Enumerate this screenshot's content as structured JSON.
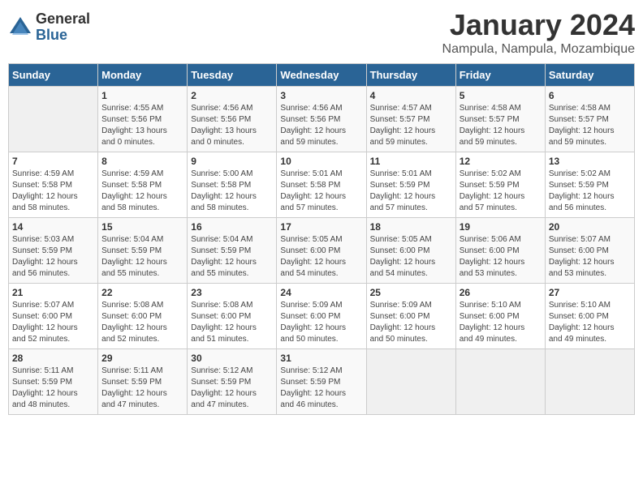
{
  "logo": {
    "general": "General",
    "blue": "Blue"
  },
  "title": "January 2024",
  "location": "Nampula, Nampula, Mozambique",
  "days_of_week": [
    "Sunday",
    "Monday",
    "Tuesday",
    "Wednesday",
    "Thursday",
    "Friday",
    "Saturday"
  ],
  "weeks": [
    [
      {
        "day": "",
        "info": ""
      },
      {
        "day": "1",
        "info": "Sunrise: 4:55 AM\nSunset: 5:56 PM\nDaylight: 13 hours\nand 0 minutes."
      },
      {
        "day": "2",
        "info": "Sunrise: 4:56 AM\nSunset: 5:56 PM\nDaylight: 13 hours\nand 0 minutes."
      },
      {
        "day": "3",
        "info": "Sunrise: 4:56 AM\nSunset: 5:56 PM\nDaylight: 12 hours\nand 59 minutes."
      },
      {
        "day": "4",
        "info": "Sunrise: 4:57 AM\nSunset: 5:57 PM\nDaylight: 12 hours\nand 59 minutes."
      },
      {
        "day": "5",
        "info": "Sunrise: 4:58 AM\nSunset: 5:57 PM\nDaylight: 12 hours\nand 59 minutes."
      },
      {
        "day": "6",
        "info": "Sunrise: 4:58 AM\nSunset: 5:57 PM\nDaylight: 12 hours\nand 59 minutes."
      }
    ],
    [
      {
        "day": "7",
        "info": "Sunrise: 4:59 AM\nSunset: 5:58 PM\nDaylight: 12 hours\nand 58 minutes."
      },
      {
        "day": "8",
        "info": "Sunrise: 4:59 AM\nSunset: 5:58 PM\nDaylight: 12 hours\nand 58 minutes."
      },
      {
        "day": "9",
        "info": "Sunrise: 5:00 AM\nSunset: 5:58 PM\nDaylight: 12 hours\nand 58 minutes."
      },
      {
        "day": "10",
        "info": "Sunrise: 5:01 AM\nSunset: 5:58 PM\nDaylight: 12 hours\nand 57 minutes."
      },
      {
        "day": "11",
        "info": "Sunrise: 5:01 AM\nSunset: 5:59 PM\nDaylight: 12 hours\nand 57 minutes."
      },
      {
        "day": "12",
        "info": "Sunrise: 5:02 AM\nSunset: 5:59 PM\nDaylight: 12 hours\nand 57 minutes."
      },
      {
        "day": "13",
        "info": "Sunrise: 5:02 AM\nSunset: 5:59 PM\nDaylight: 12 hours\nand 56 minutes."
      }
    ],
    [
      {
        "day": "14",
        "info": "Sunrise: 5:03 AM\nSunset: 5:59 PM\nDaylight: 12 hours\nand 56 minutes."
      },
      {
        "day": "15",
        "info": "Sunrise: 5:04 AM\nSunset: 5:59 PM\nDaylight: 12 hours\nand 55 minutes."
      },
      {
        "day": "16",
        "info": "Sunrise: 5:04 AM\nSunset: 5:59 PM\nDaylight: 12 hours\nand 55 minutes."
      },
      {
        "day": "17",
        "info": "Sunrise: 5:05 AM\nSunset: 6:00 PM\nDaylight: 12 hours\nand 54 minutes."
      },
      {
        "day": "18",
        "info": "Sunrise: 5:05 AM\nSunset: 6:00 PM\nDaylight: 12 hours\nand 54 minutes."
      },
      {
        "day": "19",
        "info": "Sunrise: 5:06 AM\nSunset: 6:00 PM\nDaylight: 12 hours\nand 53 minutes."
      },
      {
        "day": "20",
        "info": "Sunrise: 5:07 AM\nSunset: 6:00 PM\nDaylight: 12 hours\nand 53 minutes."
      }
    ],
    [
      {
        "day": "21",
        "info": "Sunrise: 5:07 AM\nSunset: 6:00 PM\nDaylight: 12 hours\nand 52 minutes."
      },
      {
        "day": "22",
        "info": "Sunrise: 5:08 AM\nSunset: 6:00 PM\nDaylight: 12 hours\nand 52 minutes."
      },
      {
        "day": "23",
        "info": "Sunrise: 5:08 AM\nSunset: 6:00 PM\nDaylight: 12 hours\nand 51 minutes."
      },
      {
        "day": "24",
        "info": "Sunrise: 5:09 AM\nSunset: 6:00 PM\nDaylight: 12 hours\nand 50 minutes."
      },
      {
        "day": "25",
        "info": "Sunrise: 5:09 AM\nSunset: 6:00 PM\nDaylight: 12 hours\nand 50 minutes."
      },
      {
        "day": "26",
        "info": "Sunrise: 5:10 AM\nSunset: 6:00 PM\nDaylight: 12 hours\nand 49 minutes."
      },
      {
        "day": "27",
        "info": "Sunrise: 5:10 AM\nSunset: 6:00 PM\nDaylight: 12 hours\nand 49 minutes."
      }
    ],
    [
      {
        "day": "28",
        "info": "Sunrise: 5:11 AM\nSunset: 5:59 PM\nDaylight: 12 hours\nand 48 minutes."
      },
      {
        "day": "29",
        "info": "Sunrise: 5:11 AM\nSunset: 5:59 PM\nDaylight: 12 hours\nand 47 minutes."
      },
      {
        "day": "30",
        "info": "Sunrise: 5:12 AM\nSunset: 5:59 PM\nDaylight: 12 hours\nand 47 minutes."
      },
      {
        "day": "31",
        "info": "Sunrise: 5:12 AM\nSunset: 5:59 PM\nDaylight: 12 hours\nand 46 minutes."
      },
      {
        "day": "",
        "info": ""
      },
      {
        "day": "",
        "info": ""
      },
      {
        "day": "",
        "info": ""
      }
    ]
  ]
}
